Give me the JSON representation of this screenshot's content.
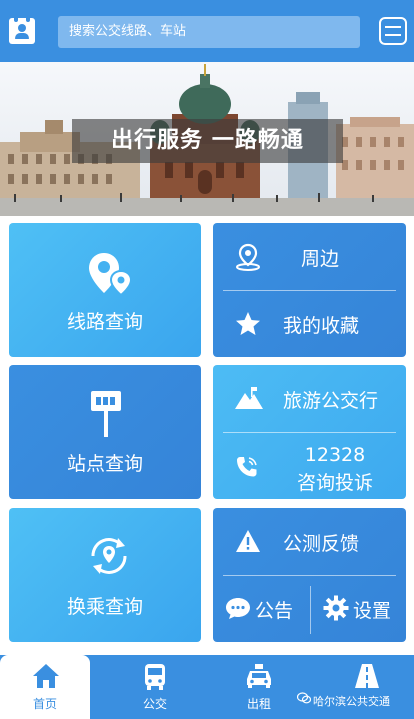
{
  "header": {
    "search_placeholder": "搜索公交线路、车站"
  },
  "banner": {
    "caption": "出行服务  一路畅通"
  },
  "grid": {
    "route_query": "线路查询",
    "nearby": "周边",
    "favorites": "我的收藏",
    "stop_query": "站点查询",
    "tourist_bus": "旅游公交行",
    "hotline_number": "12328",
    "hotline_label": "咨询投诉",
    "transfer_query": "换乘查询",
    "feedback": "公测反馈",
    "notice": "公告",
    "settings": "设置"
  },
  "bottom_nav": {
    "home": "首页",
    "bus": "公交",
    "taxi": "出租"
  },
  "watermark": "哈尔滨公共交通",
  "colors": {
    "primary": "#3a8fe0",
    "tile_light": "#4fc0f5",
    "white": "#ffffff"
  },
  "icons": [
    "profile-icon",
    "menu-icon",
    "route-pin-icon",
    "location-icon",
    "star-icon",
    "bus-stop-sign-icon",
    "mountain-icon",
    "phone-icon",
    "transfer-icon",
    "warning-icon",
    "chat-icon",
    "gear-icon",
    "home-icon",
    "bus-icon",
    "taxi-icon",
    "road-icon",
    "wechat-icon"
  ]
}
